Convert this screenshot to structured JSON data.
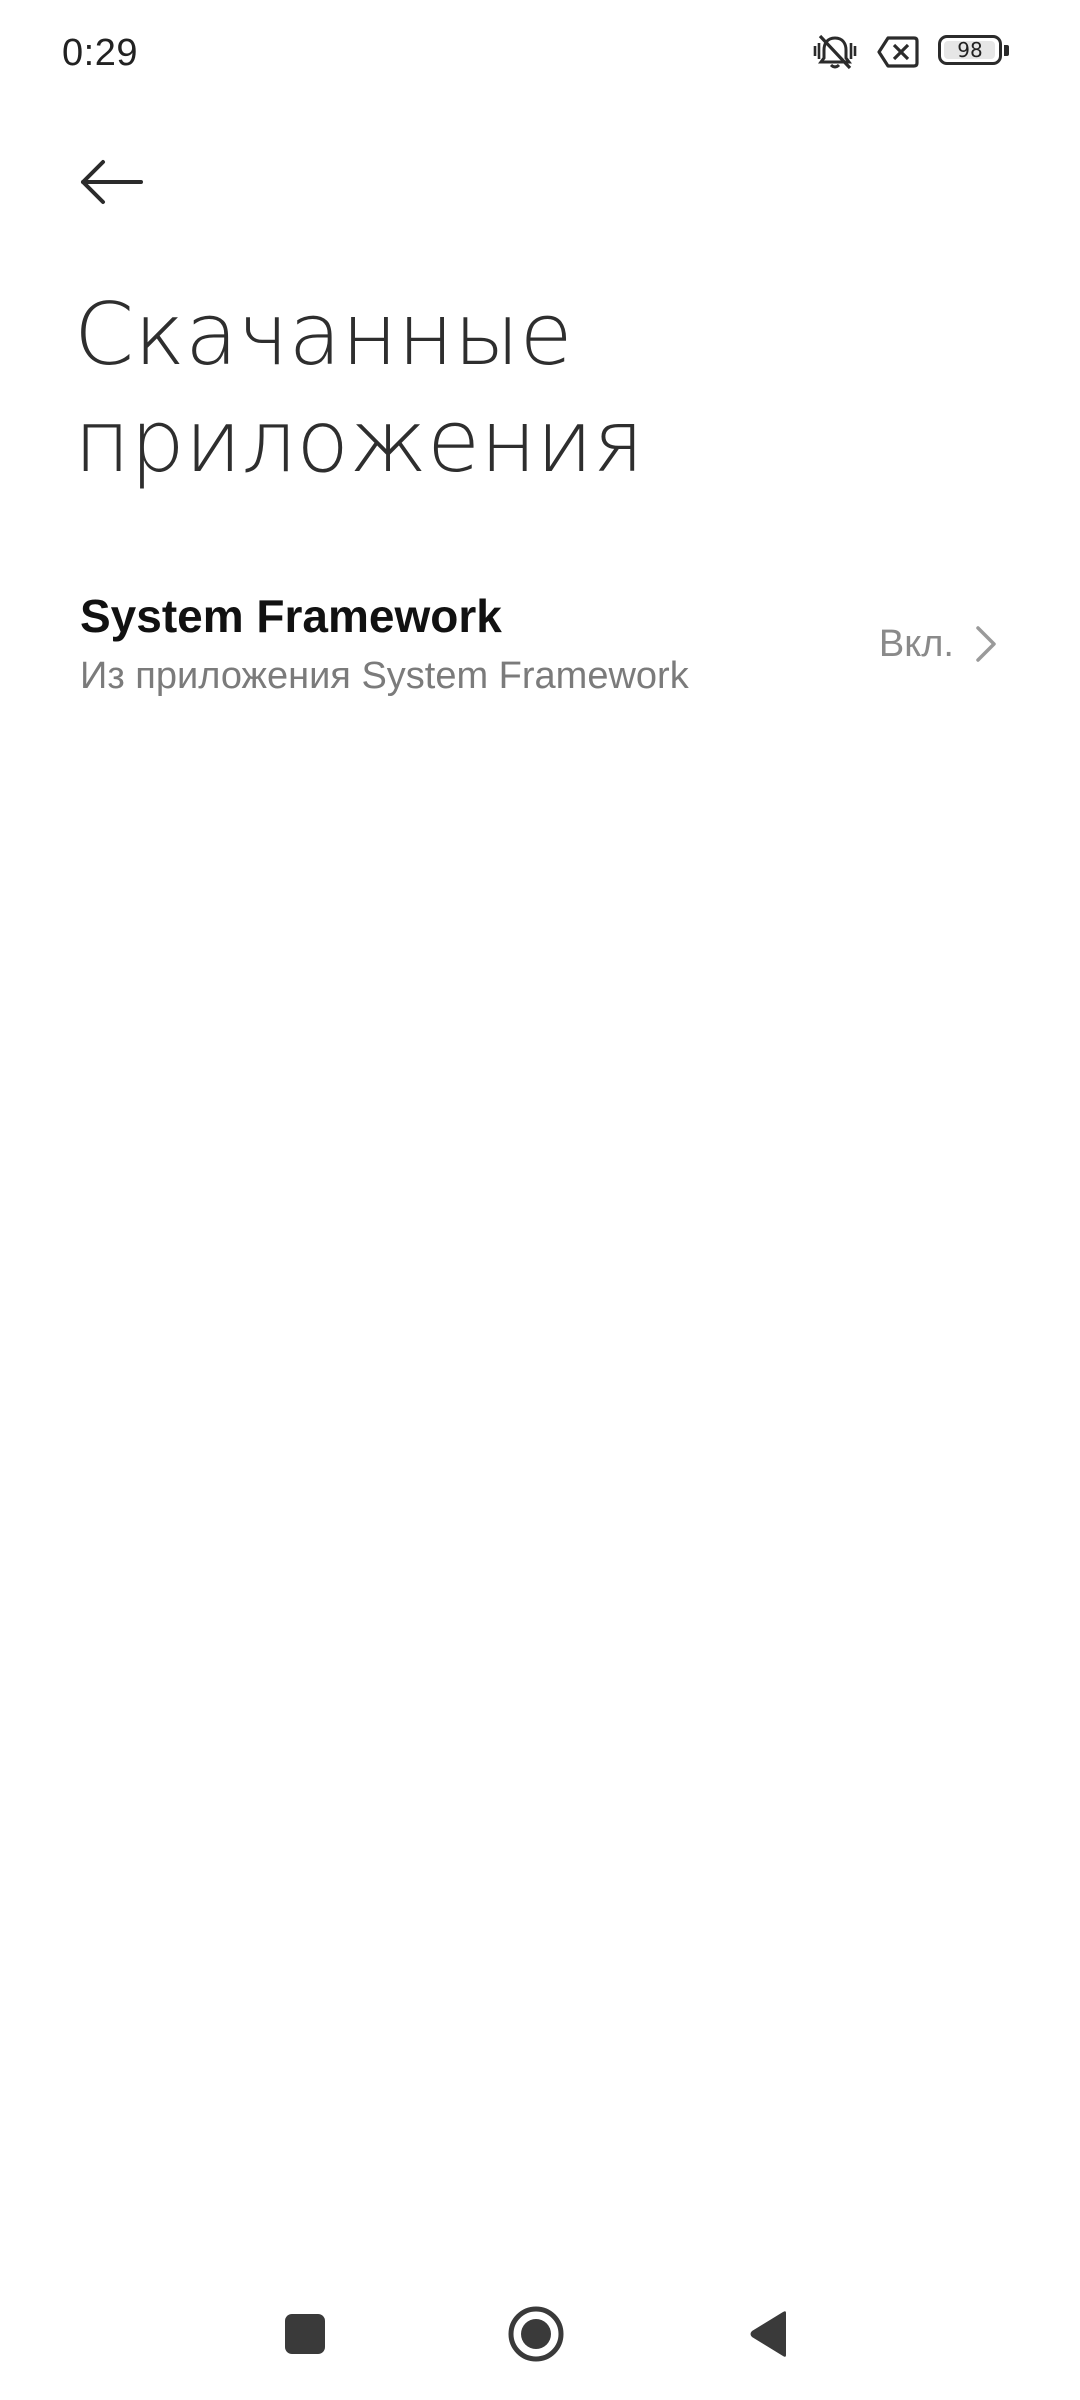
{
  "status_bar": {
    "time": "0:29",
    "icons": [
      "vibrate-muted-icon",
      "no-sim-icon",
      "battery-icon"
    ],
    "battery_level": "98",
    "battery_fraction": 0.98
  },
  "header": {
    "back_icon": "arrow-left-icon",
    "title_line1": "Скачанные",
    "title_line2": "приложения"
  },
  "apps": [
    {
      "name": "System Framework",
      "source": "Из приложения System Framework",
      "status": "Вкл.",
      "chevron_icon": "chevron-right-icon"
    }
  ],
  "nav_bar": {
    "recents_icon": "square-icon",
    "home_icon": "circle-icon",
    "back_icon": "triangle-back-icon"
  },
  "colors": {
    "background": "#ffffff",
    "title_text": "#2e2e2e",
    "primary_text": "#111111",
    "secondary_text": "#7b7b7b",
    "icon": "#2b2b2b"
  }
}
